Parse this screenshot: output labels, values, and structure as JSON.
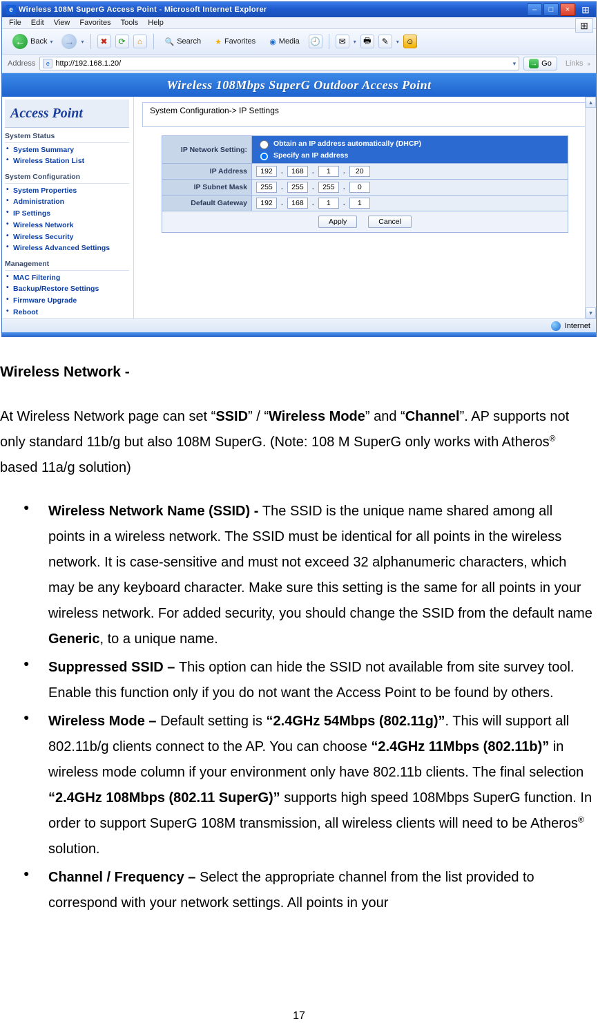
{
  "ie": {
    "title": "Wireless 108M SuperG Access Point - Microsoft Internet Explorer",
    "menus": [
      "File",
      "Edit",
      "View",
      "Favorites",
      "Tools",
      "Help"
    ],
    "toolbar": {
      "back": "Back",
      "search": "Search",
      "favorites": "Favorites",
      "media": "Media"
    },
    "address_label": "Address",
    "address_value": "http://192.168.1.20/",
    "go": "Go",
    "links": "Links",
    "status_zone": "Internet"
  },
  "ap": {
    "banner": "Wireless 108Mbps SuperG Outdoor Access Point",
    "nav_title": "Access Point",
    "groups": [
      {
        "header": "System Status",
        "items": [
          "System Summary",
          "Wireless Station List"
        ]
      },
      {
        "header": "System Configuration",
        "items": [
          "System Properties",
          "Administration",
          "IP Settings",
          "Wireless Network",
          "Wireless Security",
          "Wireless Advanced Settings"
        ]
      },
      {
        "header": "Management",
        "items": [
          "MAC Filtering",
          "Backup/Restore Settings",
          "Firmware Upgrade",
          "Reboot"
        ]
      }
    ],
    "breadcrumb": "System Configuration-> IP Settings",
    "form": {
      "row1_label": "IP Network Setting:",
      "row1_opts": [
        "Obtain an IP address automatically (DHCP)",
        "Specify an IP address"
      ],
      "row2_label": "IP Address",
      "row2_vals": [
        "192",
        "168",
        "1",
        "20"
      ],
      "row3_label": "IP Subnet Mask",
      "row3_vals": [
        "255",
        "255",
        "255",
        "0"
      ],
      "row4_label": "Default Gateway",
      "row4_vals": [
        "192",
        "168",
        "1",
        "1"
      ],
      "apply": "Apply",
      "cancel": "Cancel"
    }
  },
  "doc": {
    "heading": "Wireless Network -",
    "intro_1a": "At Wireless Network page can set “",
    "intro_ssid": "SSID",
    "intro_1b": "” / “",
    "intro_wm": "Wireless Mode",
    "intro_1c": "” and “",
    "intro_ch": "Channel",
    "intro_1d": "”. AP supports not only standard 11b/g but also 108M SuperG. (Note: 108 M SuperG only works with Atheros",
    "intro_1e": " based 11a/g solution)",
    "reg": "®",
    "b1_lead": "Wireless Network Name (SSID) - ",
    "b1_body_a": "The SSID is the unique name shared among all points in a wireless network. The SSID must be identical for all points in the wireless network. It is case-sensitive and must not exceed 32 alphanumeric characters, which may be any keyboard character. Make sure this setting is the same for all points in your wireless network. For added security, you should change the SSID from the default name ",
    "b1_generic": "Generic",
    "b1_body_b": ", to a unique name.",
    "b2_lead": "Suppressed SSID – ",
    "b2_body": "This option can hide the SSID not available from site survey tool. Enable this function only if you do not want the Access Point to be found by others.",
    "b3_lead": "Wireless Mode – ",
    "b3_body_a": "Default setting is ",
    "b3_mode_g": "“2.4GHz 54Mbps (802.11g)”",
    "b3_body_b": ". This will support all 802.11b/g clients connect to the AP. You can choose ",
    "b3_mode_b": "“2.4GHz 11Mbps (802.11b)”",
    "b3_body_c": " in wireless mode column if your environment only have 802.11b clients. The final selection ",
    "b3_mode_s": "“2.4GHz 108Mbps (802.11 SuperG)”",
    "b3_body_d": " supports high speed 108Mbps SuperG function. In order to support SuperG 108M transmission, all wireless clients will need to be Atheros",
    "b3_body_e": " solution.",
    "b4_lead": "Channel / Frequency – ",
    "b4_body": "Select the appropriate channel from the list provided to correspond with your network settings. All points in your",
    "pagenum": "17"
  }
}
